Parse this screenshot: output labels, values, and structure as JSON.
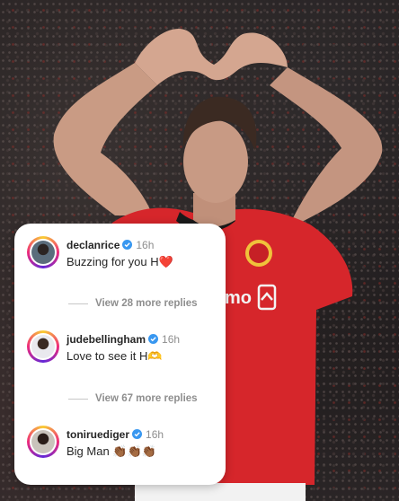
{
  "comments": [
    {
      "username": "declanrice",
      "time": "16h",
      "text": "Buzzing for you H",
      "emoji": "❤️",
      "more_replies": "View 28 more replies"
    },
    {
      "username": "judebellingham",
      "time": "16h",
      "text": "Love to see it H",
      "emoji": "🫶",
      "more_replies": "View 67 more replies"
    },
    {
      "username": "toniruediger",
      "time": "16h",
      "text": "Big Man",
      "emoji": "👏🏾👏🏾👏🏾"
    }
  ],
  "colors": {
    "verified": "#3897f0",
    "jersey_red": "#d6262b",
    "text_primary": "#262626",
    "text_secondary": "#8e8e8e"
  }
}
